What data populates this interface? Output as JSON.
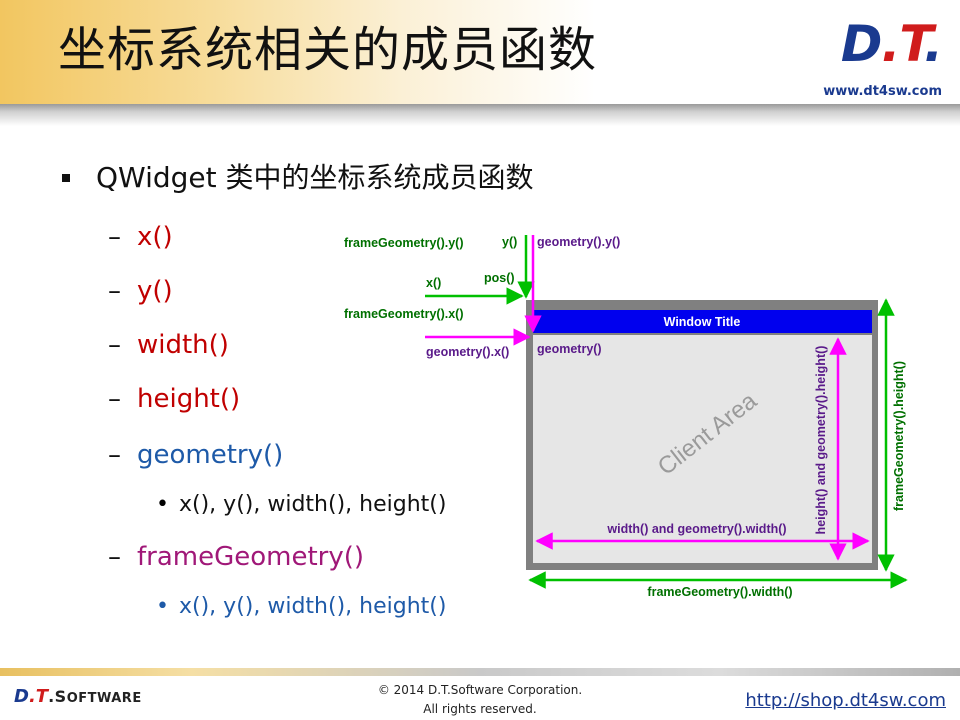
{
  "header": {
    "title": "坐标系统相关的成员函数",
    "logo_text_a": "D",
    "logo_text_b": ".T",
    "logo_text_c": ".",
    "logo_url": "www.dt4sw.com"
  },
  "bullets": {
    "level1": "QWidget  类中的坐标系统成员函数",
    "dash": "–",
    "dot": "•",
    "items": [
      {
        "label": "x()",
        "color": "#c00000"
      },
      {
        "label": "y()",
        "color": "#c00000"
      },
      {
        "label": "width()",
        "color": "#c00000"
      },
      {
        "label": "height()",
        "color": "#c00000"
      },
      {
        "label": "geometry()",
        "color": "#1e5aa8"
      },
      {
        "label": "frameGeometry()",
        "color": "#a01878"
      }
    ],
    "sub_geometry": "x(), y(), width(), height()",
    "sub_frame": "x(), y(), width(), height()"
  },
  "diagram": {
    "frame_geometry_y": "frameGeometry().y()",
    "y": "y()",
    "geometry_y": "geometry().y()",
    "x": "x()",
    "pos": "pos()",
    "frame_geometry_x": "frameGeometry().x()",
    "geometry_x": "geometry().x()",
    "window_title": "Window Title",
    "geometry": "geometry()",
    "client_area": "Client Area",
    "height_label": "height() and geometry().height()",
    "frame_height_label": "frameGeometry().height()",
    "width_label": "width() and geometry().width()",
    "frame_width_label": "frameGeometry().width()",
    "colors": {
      "green": "#00c000",
      "magenta": "#ff00ff",
      "green_text": "#007000",
      "purple_text": "#5a1a8a",
      "title_bar": "#0000ee",
      "frame": "#808080",
      "client": "#e6e6e6"
    }
  },
  "footer": {
    "logo_a": "D",
    "logo_b": ".T",
    "logo_c": ".S",
    "logo_d": "OFTWARE",
    "copyright_line1": "© 2014 D.T.Software Corporation.",
    "copyright_line2": "All rights reserved.",
    "link": "http://shop.dt4sw.com"
  }
}
